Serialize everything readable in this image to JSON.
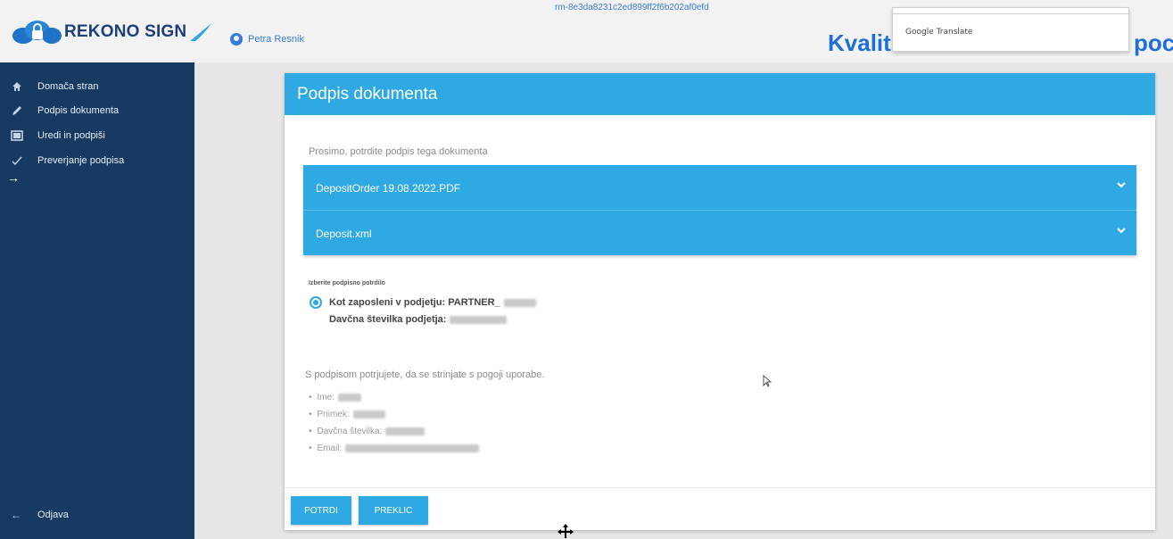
{
  "header": {
    "logo_text": "REKONO SIGN",
    "user_name": "Petra Resnik",
    "session_hash": "rm-8e3da8231c2ed899ff2f6b202af0efd",
    "heading_start": "Kvalit",
    "heading_end": "poc",
    "translate_popup": "Google Translate"
  },
  "sidebar": {
    "items": [
      {
        "label": "Domača stran",
        "icon": "home-icon"
      },
      {
        "label": "Podpis dokumenta",
        "icon": "pen-icon"
      },
      {
        "label": "Uredi in podpiši",
        "icon": "document-icon"
      },
      {
        "label": "Preverjanje podpisa",
        "icon": "check-icon"
      }
    ],
    "logout_label": "Odjava"
  },
  "card": {
    "title": "Podpis dokumenta",
    "prompt": "Prosimo, potrdite podpis tega dokumenta",
    "documents": [
      {
        "name": "DepositOrder 19.08.2022.PDF"
      },
      {
        "name": "Deposit.xml"
      }
    ],
    "certificate_label": "Izberite podpisno potrdilo",
    "certificate_option": "Kot zaposleni v podjetju: PARTNER_",
    "company_tax_label": "Davčna številka podjetja:",
    "terms_text": "S podpisom potrjujete, da se strinjate s pogoji uporabe.",
    "terms_fields": [
      "Ime:",
      "Priimek:",
      "Davčna številka:",
      "Email:"
    ],
    "confirm_label": "POTRDI",
    "cancel_label": "PREKLIC"
  },
  "colors": {
    "accent": "#2ea9e4",
    "sidebar": "#163a61",
    "brand": "#1e3f7a"
  }
}
